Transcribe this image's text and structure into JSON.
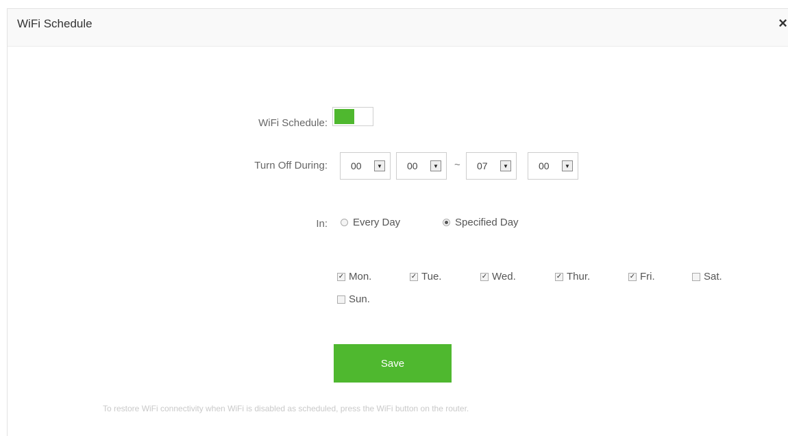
{
  "dialog": {
    "title": "WiFi Schedule",
    "close_label": "×"
  },
  "schedule": {
    "label": "WiFi Schedule:",
    "enabled": true
  },
  "turn_off": {
    "label": "Turn Off During:",
    "start_hour": "00",
    "start_minute": "00",
    "separator": "~",
    "end_hour": "07",
    "end_minute": "00",
    "arrow_glyph": "▼"
  },
  "repeat": {
    "label": "In:",
    "options": [
      {
        "label": "Every Day",
        "selected": false
      },
      {
        "label": "Specified Day",
        "selected": true
      }
    ]
  },
  "days": [
    {
      "label": "Mon.",
      "checked": true
    },
    {
      "label": "Tue.",
      "checked": true
    },
    {
      "label": "Wed.",
      "checked": true
    },
    {
      "label": "Thur.",
      "checked": true
    },
    {
      "label": "Fri.",
      "checked": true
    },
    {
      "label": "Sat.",
      "checked": false
    },
    {
      "label": "Sun.",
      "checked": false
    }
  ],
  "check_glyph": "✓",
  "save_label": "Save",
  "footnote": "To restore WiFi connectivity when WiFi is disabled as scheduled, press the WiFi button on the router.",
  "colors": {
    "accent": "#4fb82f"
  }
}
